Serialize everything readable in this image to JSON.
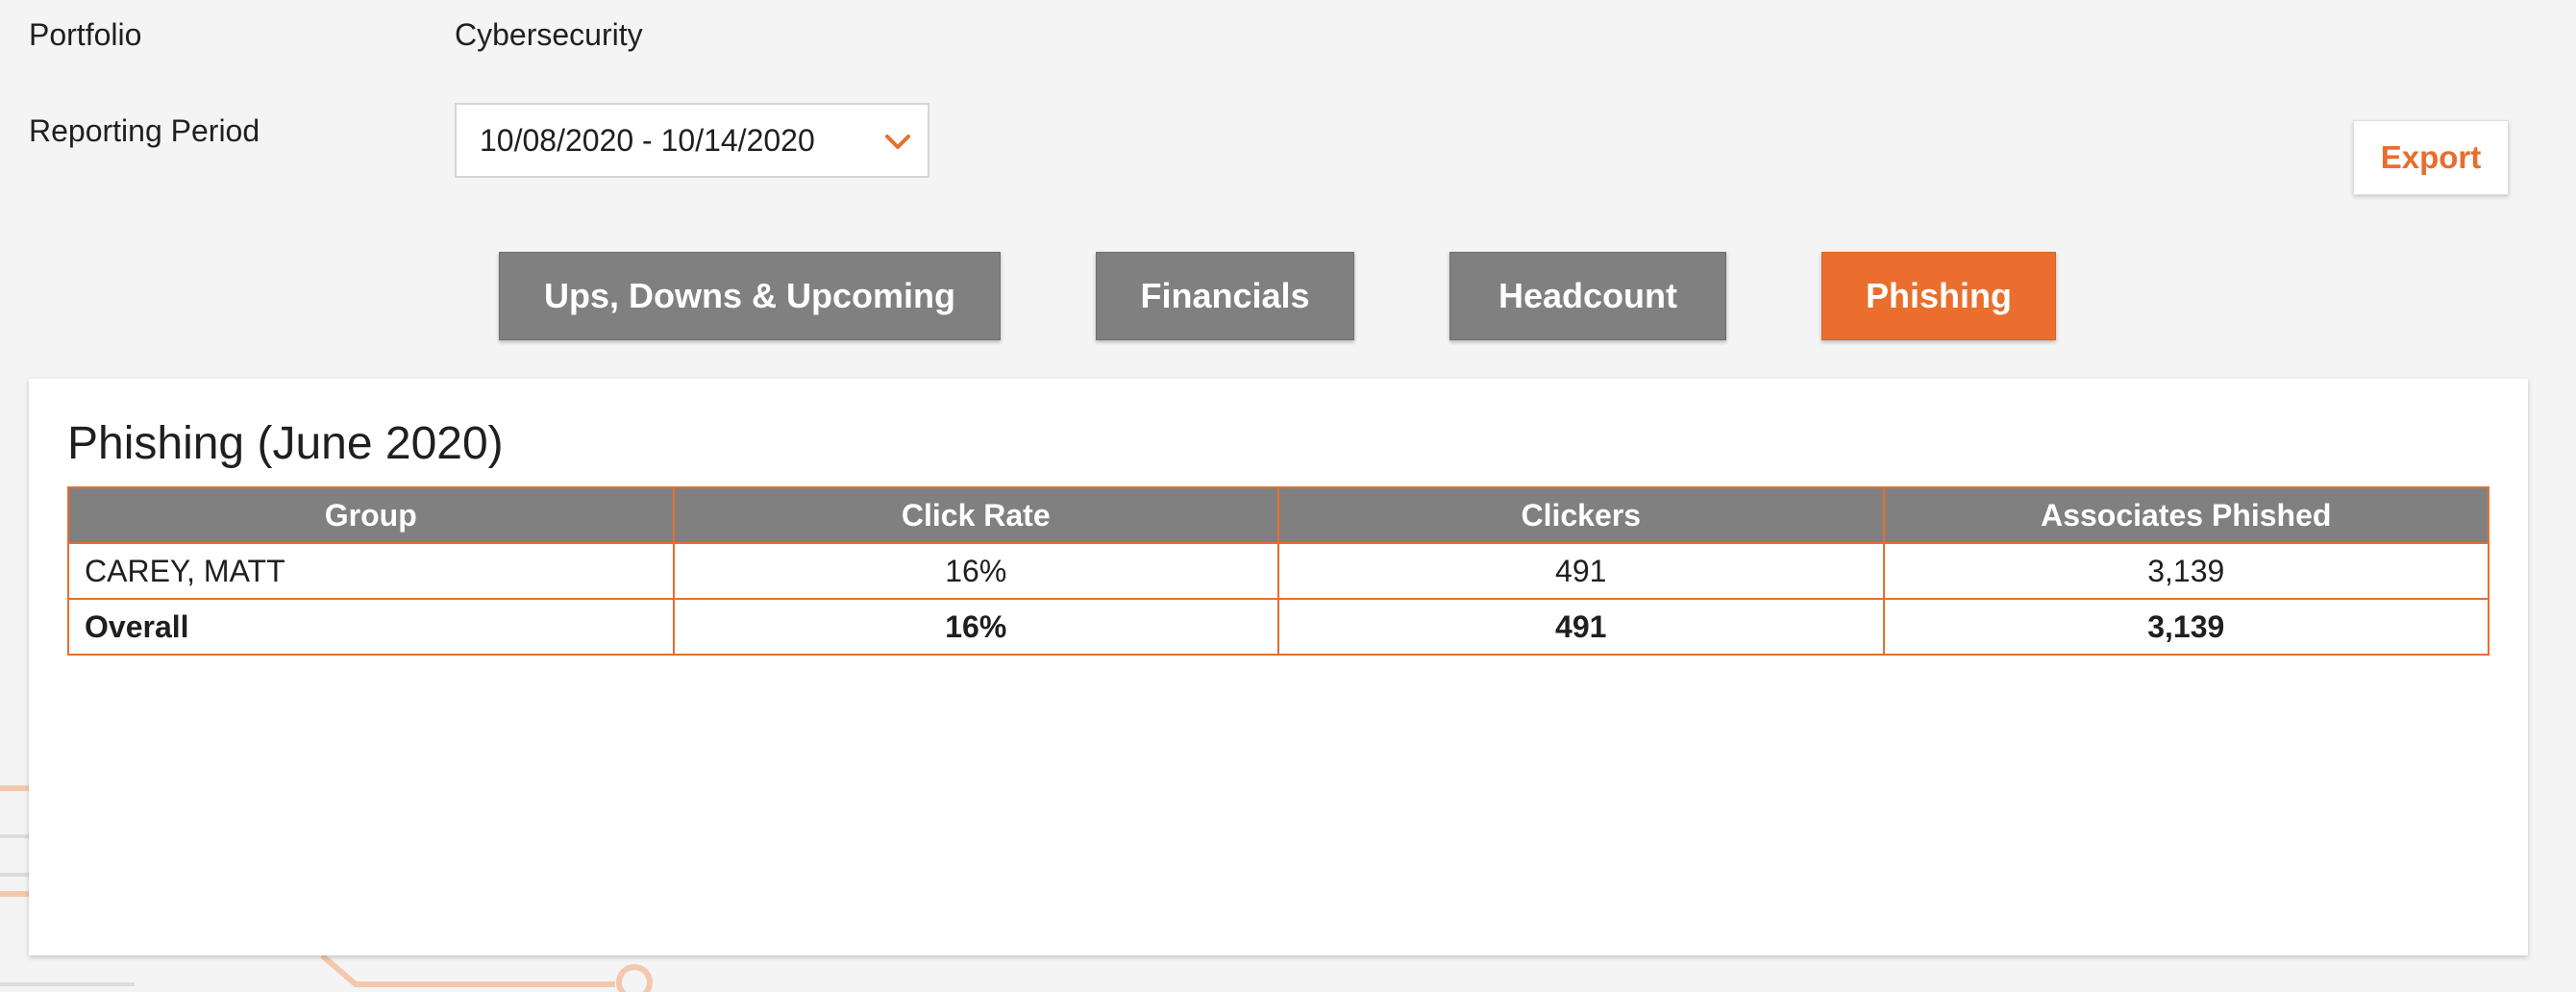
{
  "filters": {
    "portfolio_label": "Portfolio",
    "portfolio_value": "Cybersecurity",
    "period_label": "Reporting Period",
    "period_value": "10/08/2020 - 10/14/2020"
  },
  "actions": {
    "export_label": "Export"
  },
  "tabs": [
    {
      "label": "Ups, Downs & Upcoming",
      "active": false
    },
    {
      "label": "Financials",
      "active": false
    },
    {
      "label": "Headcount",
      "active": false
    },
    {
      "label": "Phishing",
      "active": true
    }
  ],
  "report": {
    "title": "Phishing (June 2020)",
    "columns": [
      "Group",
      "Click Rate",
      "Clickers",
      "Associates Phished"
    ],
    "rows": [
      [
        "CAREY, MATT",
        "16%",
        "491",
        "3,139"
      ]
    ],
    "total_row": [
      "Overall",
      "16%",
      "491",
      "3,139"
    ]
  },
  "colors": {
    "accent": "#ea6e2d",
    "tab_inactive": "#808080",
    "table_header": "#808080",
    "page_bg": "#f4f4f4"
  },
  "icons": {
    "dropdown": "chevron-down-icon"
  }
}
